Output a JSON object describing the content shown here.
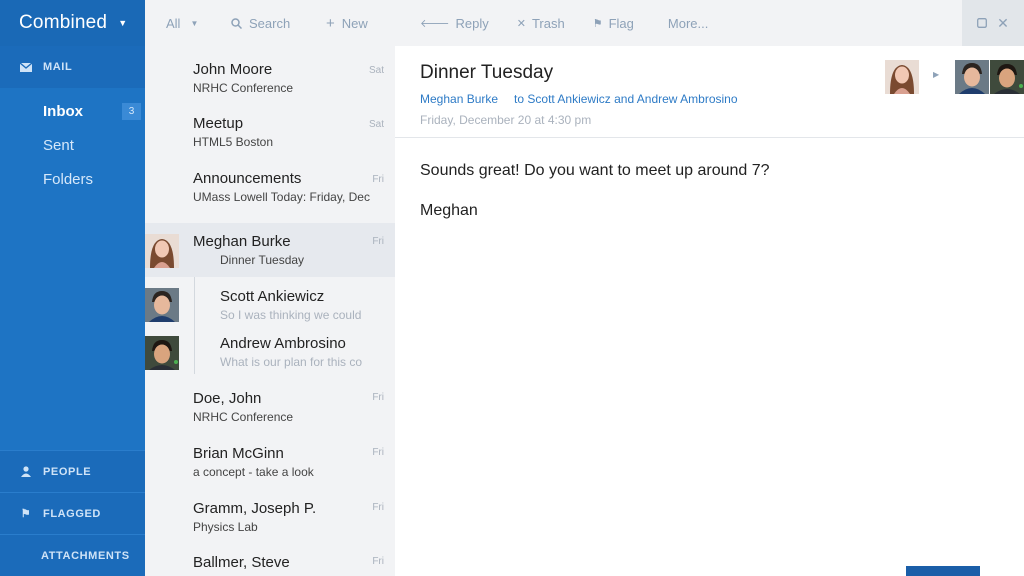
{
  "sidebar": {
    "account": "Combined",
    "mail_label": "MAIL",
    "items": [
      {
        "label": "Inbox",
        "count": "3"
      },
      {
        "label": "Sent"
      },
      {
        "label": "Folders"
      }
    ],
    "people_label": "PEOPLE",
    "flagged_label": "FLAGGED",
    "attachments_label": "ATTACHMENTS"
  },
  "list_toolbar": {
    "filter": "All",
    "search": "Search",
    "new": "New"
  },
  "messages": [
    {
      "from": "John Moore",
      "subject": "NRHC Conference",
      "date": "Sat"
    },
    {
      "from": "Meetup",
      "subject": "HTML5 Boston",
      "date": "Sat"
    },
    {
      "from": "Announcements",
      "subject": "UMass Lowell Today: Friday, Dec",
      "date": "Fri"
    },
    {
      "from": "Meghan Burke",
      "subject": "Dinner Tuesday",
      "date": "Fri"
    },
    {
      "from": "Scott Ankiewicz",
      "subject": "So I was thinking we could"
    },
    {
      "from": "Andrew Ambrosino",
      "subject": "What is our plan for this co"
    },
    {
      "from": "Doe, John",
      "subject": "NRHC Conference",
      "date": "Fri"
    },
    {
      "from": "Brian McGinn",
      "subject": "a concept - take a look",
      "date": "Fri"
    },
    {
      "from": "Gramm, Joseph P.",
      "subject": "Physics Lab",
      "date": "Fri"
    },
    {
      "from": "Ballmer, Steve",
      "subject": "",
      "date": "Fri"
    }
  ],
  "reader_toolbar": {
    "reply": "Reply",
    "trash": "Trash",
    "flag": "Flag",
    "more": "More..."
  },
  "reader": {
    "subject": "Dinner Tuesday",
    "from": "Meghan Burke",
    "to": "to Scott Ankiewicz and Andrew Ambrosino",
    "date": "Friday, December 20 at 4:30 pm",
    "body_line1": "Sounds great! Do you want to meet up around 7?",
    "body_line2": "Meghan"
  },
  "colors": {
    "sidebar": "#1e74c4",
    "link": "#2e7bc6"
  }
}
